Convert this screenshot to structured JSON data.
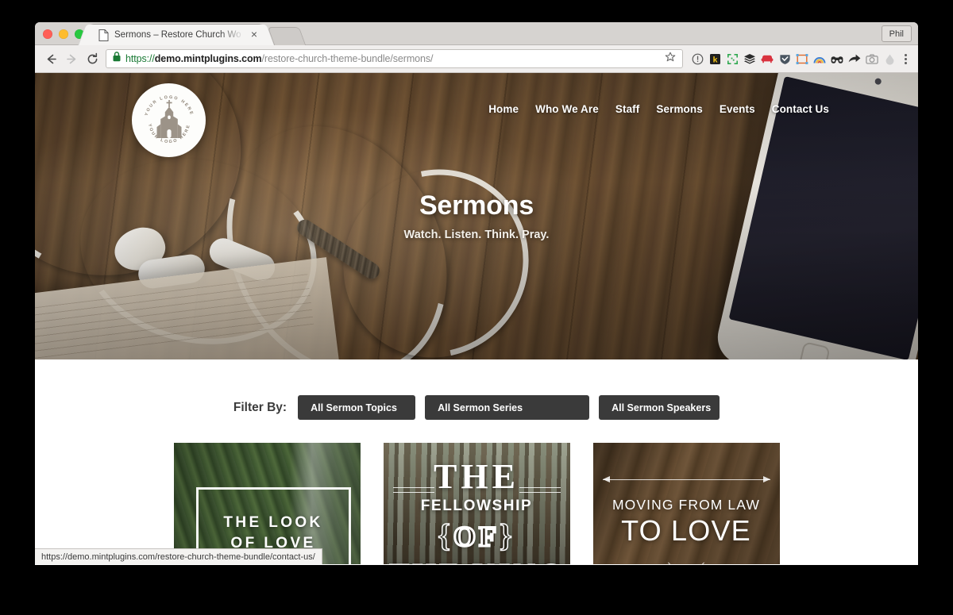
{
  "browser": {
    "tab": {
      "title": "Sermons – Restore Church Wo",
      "close_label": "×",
      "favicon": "document-icon"
    },
    "profile_label": "Phil",
    "nav": {
      "back": "back-arrow-icon",
      "forward": "forward-arrow-icon",
      "reload": "reload-icon"
    },
    "omnibox": {
      "lock": "lock-icon",
      "scheme": "https://",
      "host": "demo.mintplugins.com",
      "path": "/restore-church-theme-bundle/sermons/",
      "bookmark": "star-icon"
    },
    "extensions": [
      "info-circle-icon",
      "k-badge-icon",
      "qr-code-icon",
      "layers-icon",
      "sofa-icon",
      "shield-icon",
      "crop-frame-icon",
      "rainbow-icon",
      "binoculars-icon",
      "share-arrow-icon",
      "camera-icon",
      "drop-icon"
    ],
    "menu": "kebab-menu-icon",
    "status_bar_url": "https://demo.mintplugins.com/restore-church-theme-bundle/contact-us/"
  },
  "site": {
    "logo": {
      "top_text": "YOUR LOGO HERE",
      "bottom_text": "YOUR LOGO HERE",
      "glyph": "church-icon"
    },
    "nav_items": [
      {
        "label": "Home"
      },
      {
        "label": "Who We Are"
      },
      {
        "label": "Staff"
      },
      {
        "label": "Sermons"
      },
      {
        "label": "Events"
      },
      {
        "label": "Contact Us"
      }
    ],
    "hero": {
      "title": "Sermons",
      "subtitle": "Watch. Listen. Think. Pray."
    },
    "filter": {
      "label": "Filter By:",
      "buttons": [
        {
          "label": "All Sermon Topics"
        },
        {
          "label": "All Sermon Series"
        },
        {
          "label": "All Sermon Speakers"
        }
      ]
    },
    "sermons": [
      {
        "title": "The Look of Love",
        "art_line_1": "THE LOOK",
        "art_line_2": "OF LOVE",
        "art_style": "green-forest-waterfall"
      },
      {
        "title": "The Fellowship of the King",
        "art_line_1": "THE",
        "art_line_2": "FELLOWSHIP",
        "art_line_3": "OF",
        "art_line_4": "THE KING",
        "art_brace_left": "{",
        "art_brace_right": "}",
        "art_style": "pine-forest"
      },
      {
        "title": "Moving from Law to Love",
        "art_line_1": "MOVING FROM LAW",
        "art_line_2": "TO LOVE",
        "art_style": "warm-wood"
      }
    ]
  },
  "colors": {
    "filter_button_bg": "#3a3a3a",
    "hero_wood": "#7d5c3b",
    "page_bg": "#ffffff",
    "url_secure_green": "#1a7a35"
  }
}
